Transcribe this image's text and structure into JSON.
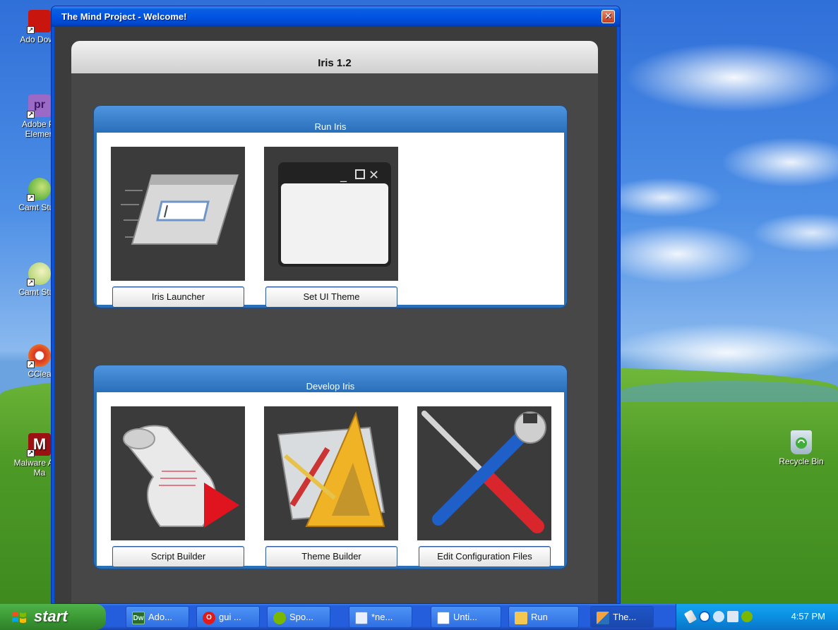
{
  "window": {
    "title": "The Mind Project - Welcome!",
    "close_label": "✕"
  },
  "header": {
    "title": "Iris 1.2"
  },
  "sections": {
    "run": {
      "title": "Run Iris",
      "buttons": [
        "Iris Launcher",
        "Set UI Theme"
      ]
    },
    "develop": {
      "title": "Develop Iris",
      "buttons": [
        "Script Builder",
        "Theme Builder",
        "Edit Configuration Files"
      ]
    }
  },
  "desktop_icons": [
    {
      "label": "Ado Down",
      "icon": "adobe-reader-icon"
    },
    {
      "label": "Adobe Pr Elemen",
      "icon": "adobe-premiere-icon"
    },
    {
      "label": "Camt Studi",
      "icon": "camtasia-icon"
    },
    {
      "label": "Camt Studi",
      "icon": "camtasia-icon"
    },
    {
      "label": "CClea",
      "icon": "ccleaner-icon"
    },
    {
      "label": "Malware Anti-Ma",
      "icon": "malwarebytes-icon"
    },
    {
      "label": "Recycle Bin",
      "icon": "recycle-bin-icon"
    }
  ],
  "taskbar": {
    "start_label": "start",
    "tasks": [
      {
        "label": "Ado...",
        "icon": "dreamweaver-icon",
        "badge": "Dw"
      },
      {
        "label": "gui ...",
        "icon": "opera-icon",
        "badge": "O"
      },
      {
        "label": "Spo...",
        "icon": "spotify-icon",
        "badge": ""
      },
      {
        "label": "*ne...",
        "icon": "notepad-icon",
        "badge": ""
      },
      {
        "label": "Unti...",
        "icon": "document-icon",
        "badge": ""
      },
      {
        "label": "Run",
        "icon": "folder-icon",
        "badge": ""
      },
      {
        "label": "The...",
        "icon": "app-window-icon",
        "badge": ""
      }
    ],
    "clock": "4:57 PM"
  },
  "colors": {
    "section_blue": "#2a6fba",
    "stage_gray": "#474747",
    "title_blue": "#0054e3"
  }
}
